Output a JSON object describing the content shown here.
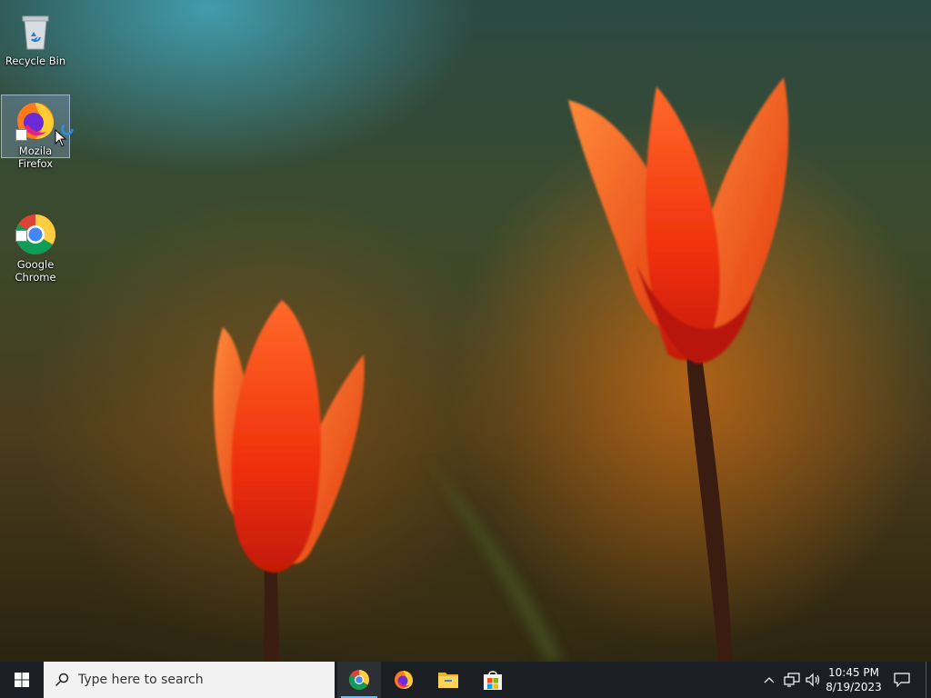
{
  "desktop": {
    "icons": [
      {
        "label": "Recycle Bin",
        "icon": "recycle-bin-icon"
      },
      {
        "label": "Mozila Firefox",
        "icon": "firefox-icon",
        "selected": true
      },
      {
        "label": "Google\nChrome",
        "icon": "chrome-icon"
      }
    ]
  },
  "taskbar": {
    "start_icon": "windows-logo-icon",
    "search": {
      "placeholder": "Type here to search",
      "icon": "search-icon"
    },
    "pinned_apps": [
      {
        "name": "chrome",
        "icon": "chrome-icon",
        "active": true
      },
      {
        "name": "firefox",
        "icon": "firefox-icon",
        "active": false
      },
      {
        "name": "file-explorer",
        "icon": "folder-icon",
        "active": false
      },
      {
        "name": "microsoft-store",
        "icon": "store-icon",
        "active": false
      }
    ],
    "tray": {
      "icons": [
        "chevron-up-icon",
        "network-icon",
        "volume-icon"
      ],
      "time": "10:45 PM",
      "date": "8/19/2023",
      "notification_icon": "notification-icon"
    }
  },
  "colors": {
    "taskbar_bg": "#1b1f24",
    "active_indicator": "#76b9ed",
    "tulip": "#ff4a12"
  }
}
